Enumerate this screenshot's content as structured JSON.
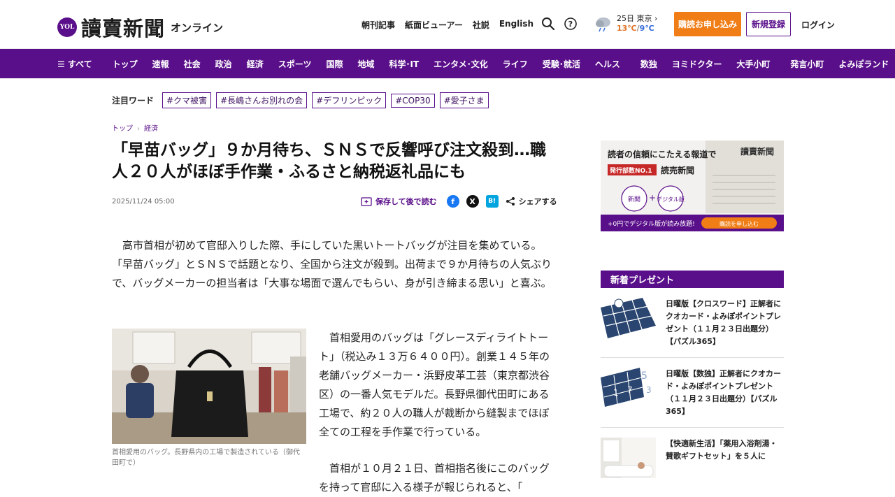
{
  "header": {
    "logo_mark": "YOL",
    "logo_text": "讀賣新聞",
    "logo_sub": "オンライン",
    "links": [
      "朝刊記事",
      "紙面ビューアー",
      "社説",
      "English"
    ],
    "weather": {
      "date_city": "25日 東京 ›",
      "high": "13℃",
      "sep": "/",
      "low": "9℃"
    },
    "subscribe": "購読お申し込み",
    "register": "新規登録",
    "login": "ログイン"
  },
  "nav": {
    "all": "☰ すべて",
    "items": [
      "トップ",
      "速報",
      "社会",
      "政治",
      "経済",
      "スポーツ",
      "国際",
      "地域",
      "科学･IT",
      "エンタメ･文化",
      "ライフ",
      "受験･就活",
      "ヘルス"
    ],
    "items2": [
      "数独",
      "ヨミドクター",
      "大手小町"
    ],
    "items3": [
      "発言小町",
      "よみぽランド"
    ]
  },
  "trend": {
    "label": "注目ワード",
    "tags": [
      "#クマ被害",
      "#長嶋さんお別れの会",
      "#デフリンピック",
      "#COP30",
      "#愛子さま"
    ]
  },
  "breadcrumb": {
    "home": "トップ",
    "sep": "›",
    "section": "経済"
  },
  "article": {
    "headline": "「早苗バッグ」９か月待ち、ＳＮＳで反響呼び注文殺到…職人２０人がほぼ手作業・ふるさと納税返礼品にも",
    "date": "2025/11/24 05:00",
    "save_later": "保存して後で読む",
    "share": "シェアする",
    "lead": "高市首相が初めて官邸入りした際、手にしていた黒いトートバッグが注目を集めている。「早苗バッグ」とＳＮＳで話題となり、全国から注文が殺到。出荷まで９か月待ちの人気ぶりで、バッグメーカーの担当者は「大事な場面で選んでもらい、身が引き締まる思い」と喜ぶ。",
    "caption": "首相愛用のバッグ。長野県内の工場で製造されている（御代田町で）",
    "para2": "首相愛用のバッグは「グレースディライトトート」（税込み１３万６４００円）。創業１４５年の老舗バッグメーカー・浜野皮革工芸（東京都渋谷区）の一番人気モデルだ。長野県御代田町にある工場で、約２０人の職人が裁断から縫製までほぼ全ての工程を手作業で行っている。",
    "para3": "首相が１０月２１日、首相指名後にこのバッグを持って官邸に入る様子が報じられると、「"
  },
  "ad": {
    "line1": "読者の信頼にこたえる報道で",
    "badge": "発行部数NO.1",
    "brand": "読売新聞",
    "circle1": "新聞",
    "plus": "+",
    "circle2": "デジタル版",
    "bottom": "+0円でデジタル版が読み放題!",
    "cta": "購読を申し込む",
    "masthead": "讀賣新聞"
  },
  "presents": {
    "heading": "新着プレゼント",
    "items": [
      {
        "text": "日曜版【クロスワード】正解者にクオカード・よみぽポイントプレゼント（１１月２３日出題分）【パズル365】"
      },
      {
        "text": "日曜版【数独】正解者にクオカード・よみぽポイントプレゼント（１１月２３日出題分）【パズル365】"
      },
      {
        "text": "【快適新生活】「薬用入浴剤湯・賛歌ギフトセット」を５人に"
      }
    ]
  },
  "colors": {
    "brand": "#5a0f8a",
    "accent": "#f07d15"
  }
}
